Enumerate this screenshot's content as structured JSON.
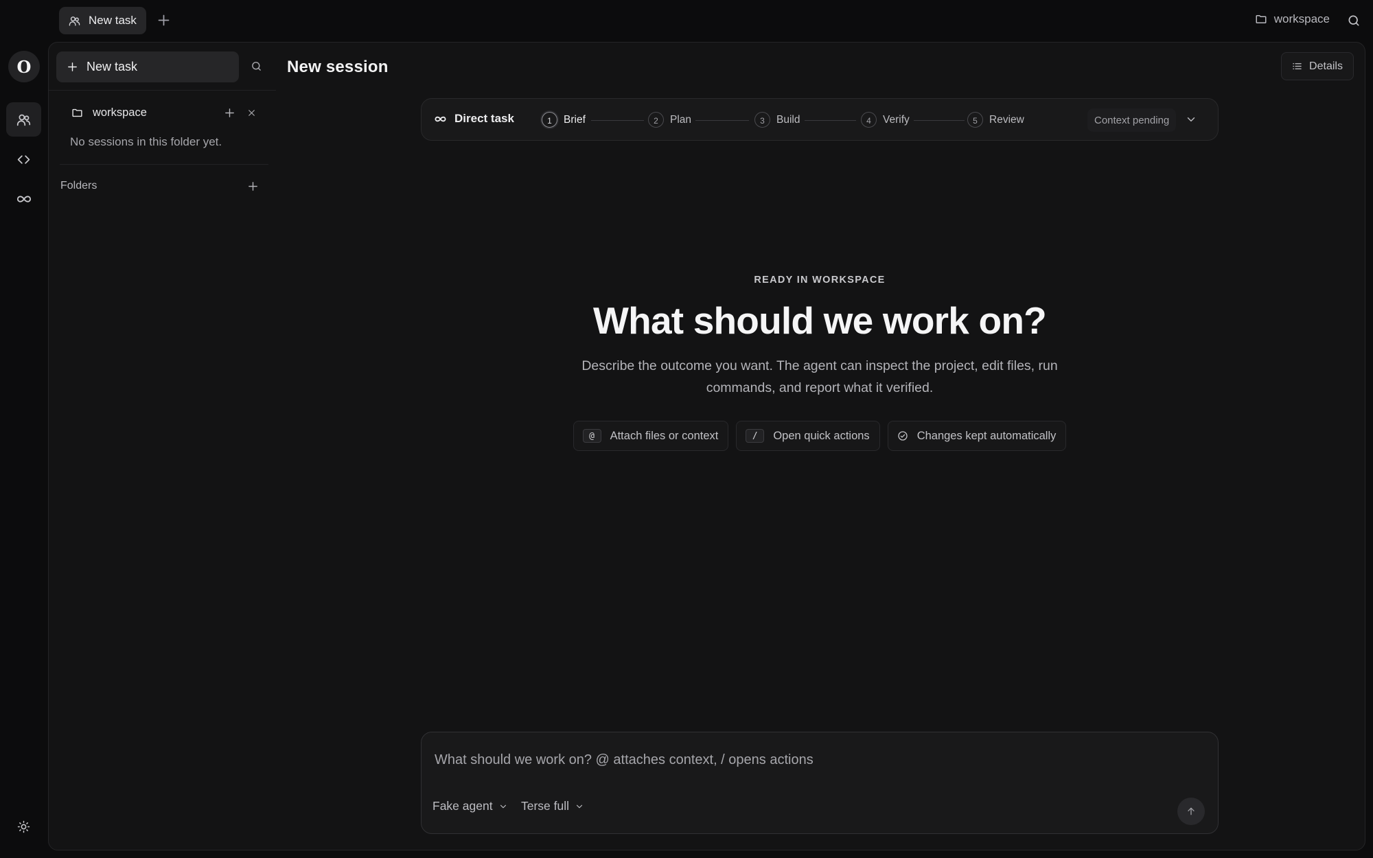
{
  "tabs": {
    "active_label": "New task",
    "add_icon": "plus-icon",
    "tab_icon": "users-icon"
  },
  "top_right": {
    "folder_label": "workspace",
    "folder_icon": "folder-icon",
    "search_icon": "search-icon"
  },
  "rail": {
    "logo_letter": "O",
    "items": [
      {
        "icon": "users-icon",
        "active": true
      },
      {
        "icon": "code-icon",
        "active": false
      },
      {
        "icon": "infinity-icon",
        "active": false
      }
    ],
    "bottom_icon": "sun-icon"
  },
  "sidebar": {
    "new_task_label": "New task",
    "folder": {
      "name": "workspace",
      "empty_text": "No sessions in this folder yet."
    },
    "folders_label": "Folders"
  },
  "main": {
    "title": "New session",
    "details_label": "Details"
  },
  "stepper": {
    "title": "Direct task",
    "steps": [
      {
        "num": "1",
        "label": "Brief",
        "current": true
      },
      {
        "num": "2",
        "label": "Plan",
        "current": false
      },
      {
        "num": "3",
        "label": "Build",
        "current": false
      },
      {
        "num": "4",
        "label": "Verify",
        "current": false
      },
      {
        "num": "5",
        "label": "Review",
        "current": false
      }
    ],
    "context_label": "Context pending"
  },
  "hero": {
    "eyebrow": "READY IN WORKSPACE",
    "title": "What should we work on?",
    "description": "Describe the outcome you want. The agent can inspect the project, edit files, run commands, and report what it verified.",
    "chips": [
      {
        "key": "@",
        "label": "Attach files or context"
      },
      {
        "key": "/",
        "label": "Open quick actions"
      },
      {
        "icon": "check-circle-icon",
        "label": "Changes kept automatically"
      }
    ]
  },
  "composer": {
    "placeholder": "What should we work on? @ attaches context, / opens actions",
    "value": "",
    "agent_select": "Fake agent",
    "mode_select": "Terse full"
  },
  "colors": {
    "background": "#0c0c0d",
    "panel": "#131314",
    "accent_text": "#f5f5f6"
  }
}
